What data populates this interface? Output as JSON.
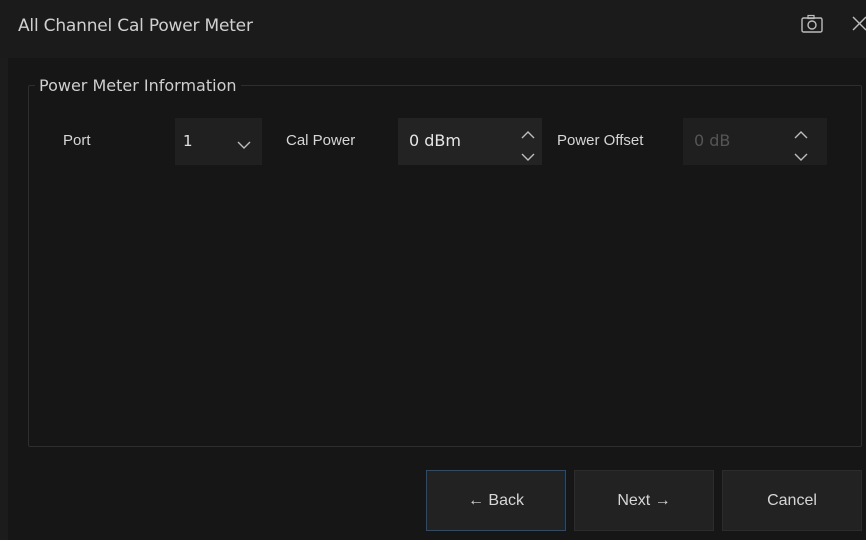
{
  "window": {
    "title": "All Channel Cal Power Meter",
    "icons": {
      "snapshot": "camera-icon",
      "close": "close-icon"
    }
  },
  "group": {
    "legend": "Power Meter Information"
  },
  "port": {
    "label": "Port",
    "value": "1",
    "icon": "chevron-down-icon"
  },
  "cal_power": {
    "label": "Cal Power",
    "value": "0 dBm",
    "icons": [
      "chevron-up-icon",
      "chevron-down-icon"
    ]
  },
  "power_offset": {
    "label": "Power Offset",
    "value": "0 dB",
    "disabled": true,
    "icons": [
      "chevron-up-icon",
      "chevron-down-icon"
    ]
  },
  "buttons": {
    "back": "← Back",
    "next": "Next →",
    "cancel": "Cancel"
  },
  "colors": {
    "background": "#1c1c1c",
    "panel": "#161616",
    "focus_border": "#1f4f7a",
    "text": "#d6d6d6",
    "disabled_text": "#555555"
  }
}
